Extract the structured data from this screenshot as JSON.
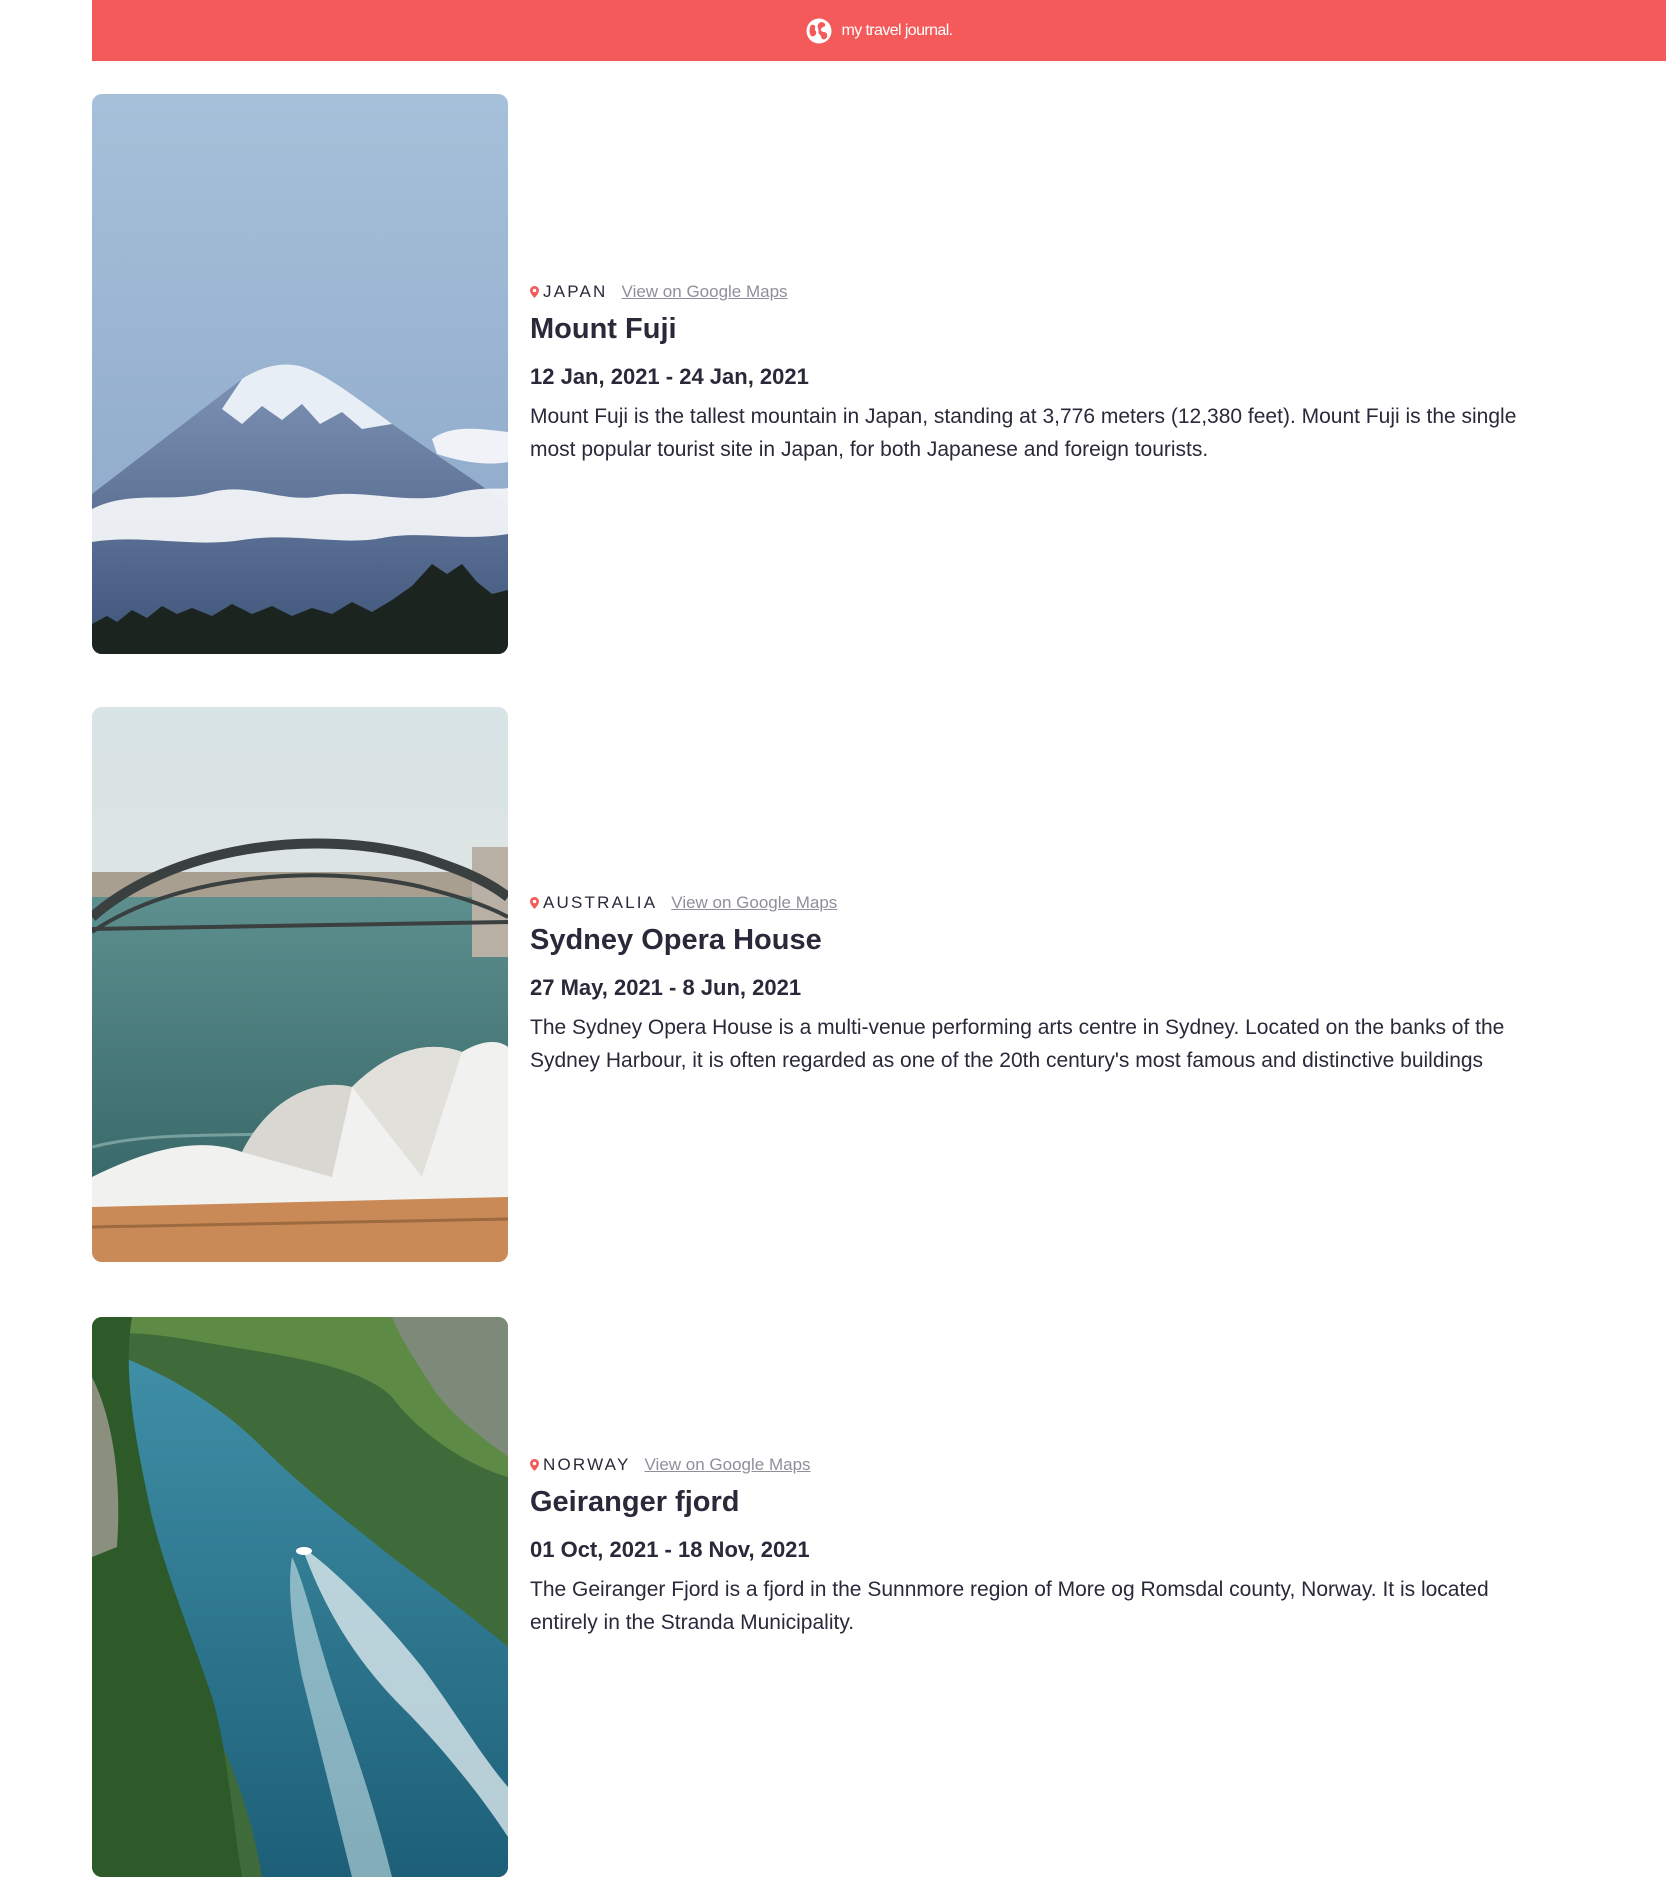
{
  "header": {
    "brand": "my travel journal.",
    "icon": "globe-icon",
    "background": "#f55a5a"
  },
  "entries": [
    {
      "country": "JAPAN",
      "maps_link": "View on Google Maps",
      "title": "Mount Fuji",
      "dates": "12 Jan, 2021 - 24 Jan, 2021",
      "description": "Mount Fuji is the tallest mountain in Japan, standing at 3,776 meters (12,380 feet). Mount Fuji is the single most popular tourist site in Japan, for both Japanese and foreign tourists."
    },
    {
      "country": "AUSTRALIA",
      "maps_link": "View on Google Maps",
      "title": "Sydney Opera House",
      "dates": "27 May, 2021 - 8 Jun, 2021",
      "description": "The Sydney Opera House is a multi-venue performing arts centre in Sydney. Located on the banks of the Sydney Harbour, it is often regarded as one of the 20th century's most famous and distinctive buildings"
    },
    {
      "country": "NORWAY",
      "maps_link": "View on Google Maps",
      "title": "Geiranger fjord",
      "dates": "01 Oct, 2021 - 18 Nov, 2021",
      "description": "The Geiranger Fjord is a fjord in the Sunnmore region of More og Romsdal county, Norway. It is located entirely in the Stranda Municipality."
    }
  ],
  "colors": {
    "accent": "#f55a5a",
    "text": "#2b283a",
    "link": "#918e9b"
  }
}
